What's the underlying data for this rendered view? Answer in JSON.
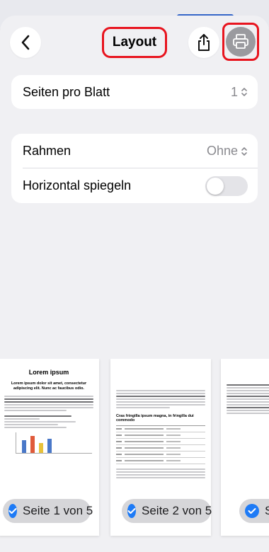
{
  "header": {
    "title": "Layout",
    "back_icon": "chevron-left-icon",
    "share_icon": "share-icon",
    "print_icon": "printer-icon"
  },
  "settings": {
    "pages_per_sheet": {
      "label": "Seiten pro Blatt",
      "value": "1"
    },
    "border": {
      "label": "Rahmen",
      "value": "Ohne"
    },
    "flip_horizontal": {
      "label": "Horizontal spiegeln",
      "on": false
    }
  },
  "previews": {
    "page1": {
      "title": "Lorem ipsum",
      "subtitle": "Lorem ipsum dolor sit amet, consectetur adipiscing elit. Nunc ac faucibus odio.",
      "badge": "Seite 1 von 5"
    },
    "page2": {
      "heading": "Cras fringilla ipsum magna, in fringilla dui commodo",
      "badge": "Seite 2 von 5"
    },
    "page3": {
      "badge": "S"
    }
  },
  "colors": {
    "accent": "#1e7bf6",
    "highlight": "#e8141e"
  }
}
